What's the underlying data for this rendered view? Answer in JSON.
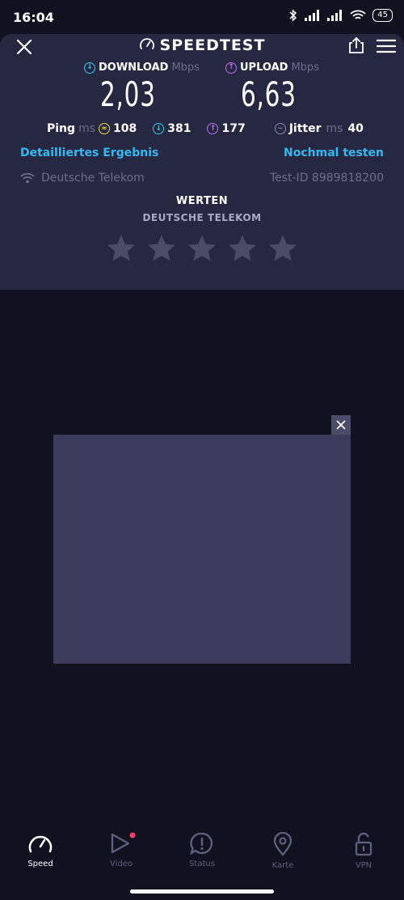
{
  "status": {
    "time": "16:04",
    "battery": "45"
  },
  "header": {
    "title": "SPEEDTEST"
  },
  "download": {
    "label": "DOWNLOAD",
    "unit": "Mbps",
    "value": "2,03"
  },
  "upload": {
    "label": "UPLOAD",
    "unit": "Mbps",
    "value": "6,63"
  },
  "ping": {
    "label": "Ping",
    "unit": "ms",
    "idle": "108",
    "download": "381",
    "upload": "177"
  },
  "jitter": {
    "label": "Jitter",
    "unit": "ms",
    "value": "40"
  },
  "links": {
    "details": "Detailliertes Ergebnis",
    "retest": "Nochmal testen"
  },
  "isp": {
    "name": "Deutsche Telekom",
    "test_id": "Test-ID 8989818200"
  },
  "rating": {
    "title": "WERTEN",
    "subtitle": "DEUTSCHE TELEKOM",
    "stars": 5,
    "filled": 0
  },
  "nav": {
    "speed": "Speed",
    "video": "Video",
    "status": "Status",
    "map": "Karte",
    "vpn": "VPN"
  },
  "colors": {
    "download": "#35c9e8",
    "upload": "#b970f3",
    "idle": "#f2d24b",
    "link": "#35b9f0",
    "notification": "#ff3b6b"
  }
}
